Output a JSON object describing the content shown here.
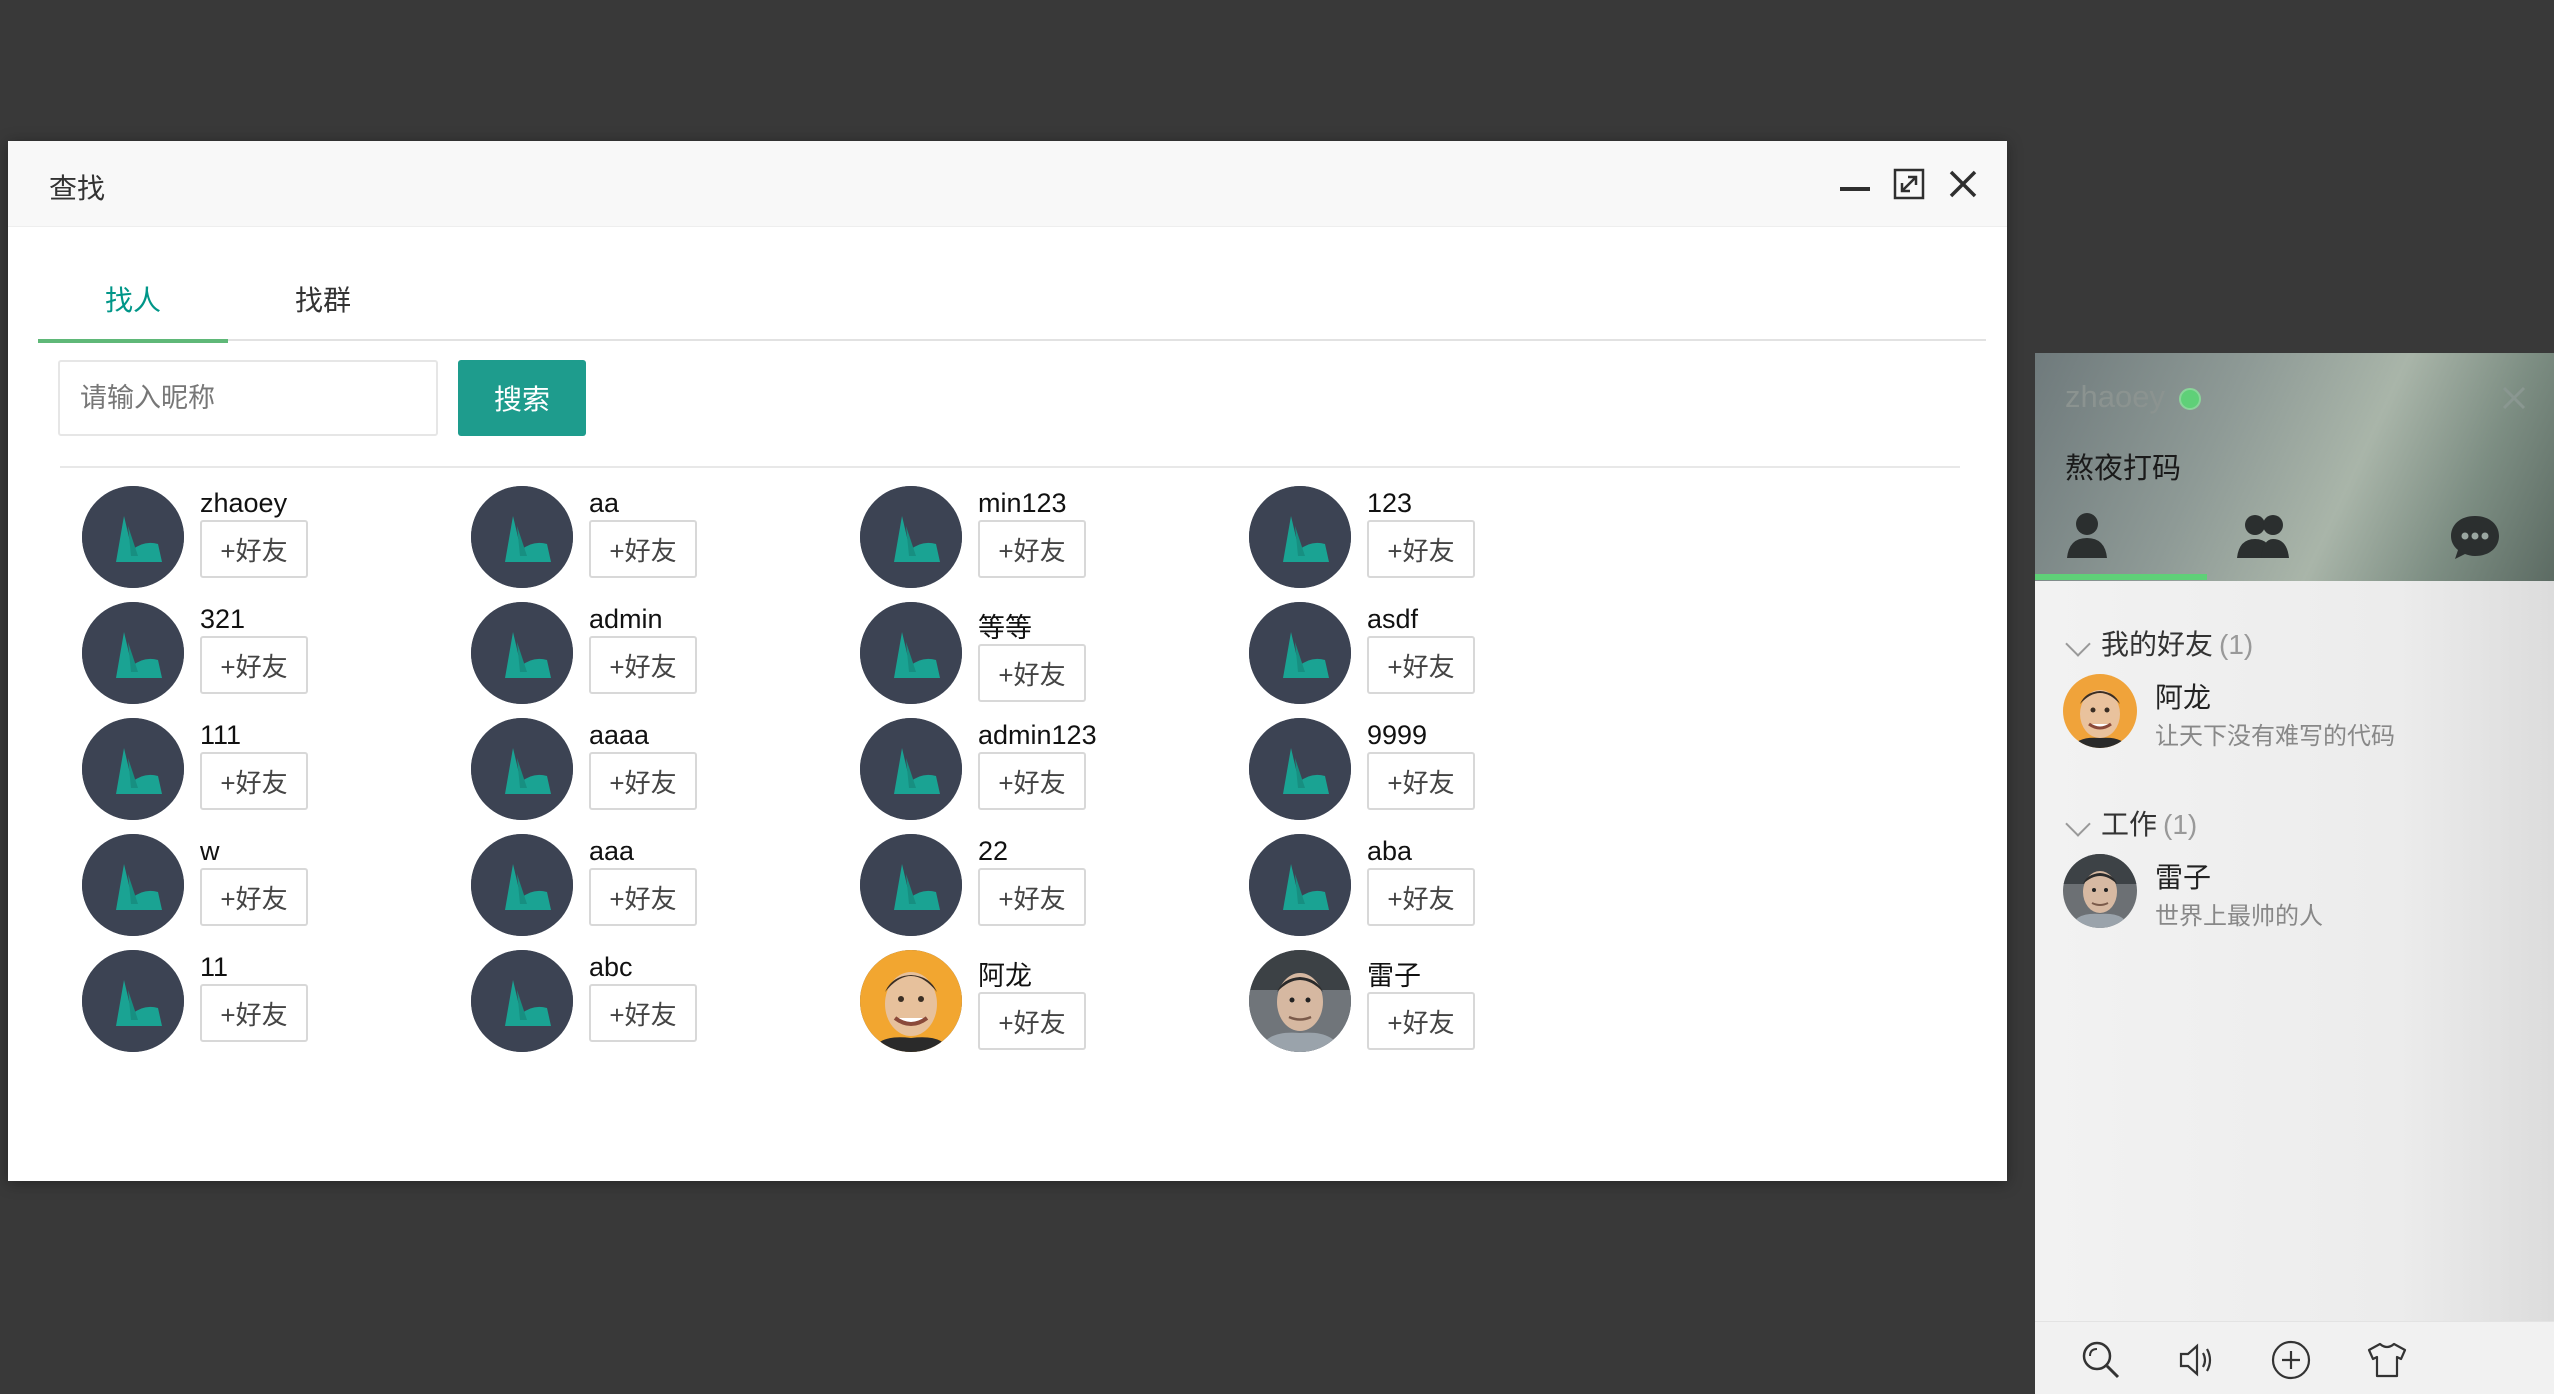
{
  "dialog": {
    "title": "查找",
    "tabs": [
      {
        "label": "找人"
      },
      {
        "label": "找群"
      }
    ],
    "search": {
      "placeholder": "请输入昵称",
      "value": "",
      "button_label": "搜索"
    },
    "add_label": "+好友",
    "results": [
      {
        "name": "zhaoey",
        "avatar": "default"
      },
      {
        "name": "aa",
        "avatar": "default"
      },
      {
        "name": "min123",
        "avatar": "default"
      },
      {
        "name": "123",
        "avatar": "default"
      },
      {
        "name": "321",
        "avatar": "default"
      },
      {
        "name": "admin",
        "avatar": "default"
      },
      {
        "name": "等等",
        "avatar": "default"
      },
      {
        "name": "asdf",
        "avatar": "default"
      },
      {
        "name": "111",
        "avatar": "default"
      },
      {
        "name": "aaaa",
        "avatar": "default"
      },
      {
        "name": "admin123",
        "avatar": "default"
      },
      {
        "name": "9999",
        "avatar": "default"
      },
      {
        "name": "w",
        "avatar": "default"
      },
      {
        "name": "aaa",
        "avatar": "default"
      },
      {
        "name": "22",
        "avatar": "default"
      },
      {
        "name": "aba",
        "avatar": "default"
      },
      {
        "name": "11",
        "avatar": "default"
      },
      {
        "name": "abc",
        "avatar": "default"
      },
      {
        "name": "阿龙",
        "avatar": "photo-orange"
      },
      {
        "name": "雷子",
        "avatar": "photo-gray"
      }
    ]
  },
  "panel": {
    "username": "zhaoey",
    "status": "online",
    "signature": "熬夜打码",
    "groups": [
      {
        "title": "我的好友",
        "count": "(1)",
        "members": [
          {
            "name": "阿龙",
            "sign": "让天下没有难写的代码",
            "avatar": "photo-orange"
          }
        ]
      },
      {
        "title": "工作",
        "count": "(1)",
        "members": [
          {
            "name": "雷子",
            "sign": "世界上最帅的人",
            "avatar": "photo-gray"
          }
        ]
      }
    ]
  },
  "colors": {
    "accent": "#009688",
    "button": "#1e9c8d",
    "online": "#5fd078",
    "avatar_bg": "#3c4353"
  }
}
